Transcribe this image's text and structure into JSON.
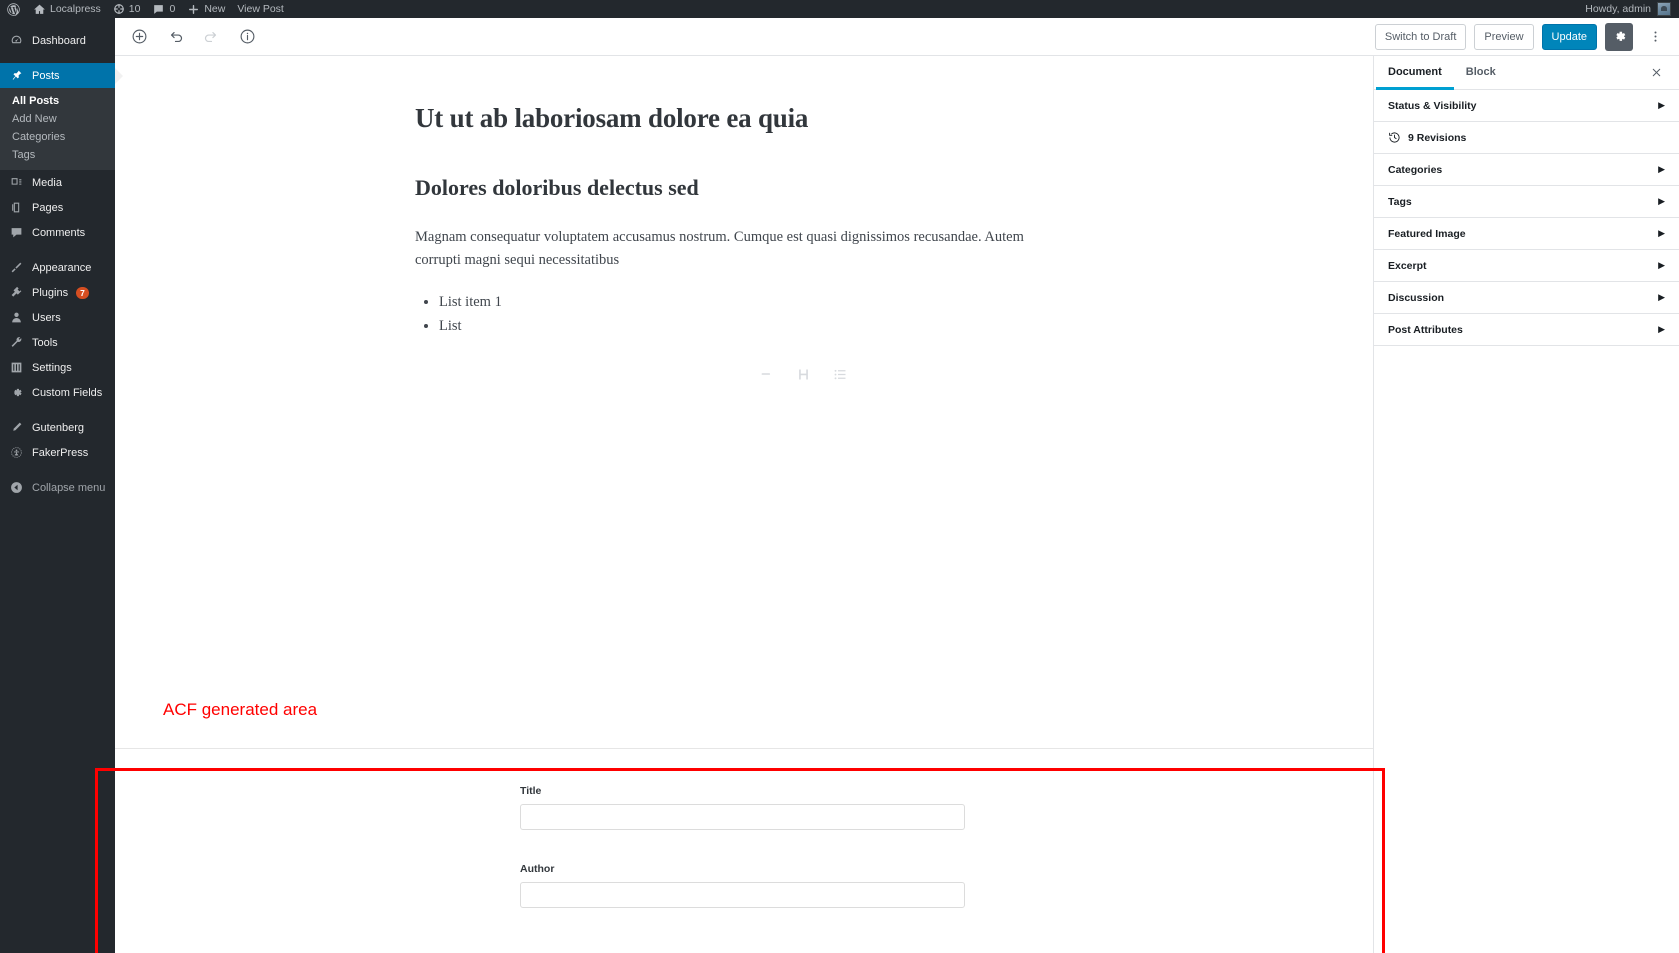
{
  "admin_bar": {
    "logo_icon": "wordpress-logo-icon",
    "items": [
      {
        "icon": "home-icon",
        "label": "Localpress"
      },
      {
        "icon": "updates-icon",
        "label": "10"
      },
      {
        "icon": "comment-icon",
        "label": "0"
      },
      {
        "icon": "plus-icon",
        "label": "New"
      },
      {
        "icon": "",
        "label": "View Post"
      }
    ],
    "account": {
      "greeting": "Howdy, admin",
      "avatar_icon": "avatar-icon"
    }
  },
  "sidebar": {
    "items": [
      {
        "label": "Dashboard",
        "icon": "dashboard-icon",
        "current": false
      },
      {
        "label": "Posts",
        "icon": "pin-icon",
        "current": true
      },
      {
        "label": "Media",
        "icon": "media-icon",
        "current": false
      },
      {
        "label": "Pages",
        "icon": "pages-icon",
        "current": false
      },
      {
        "label": "Comments",
        "icon": "comments-icon",
        "current": false
      },
      {
        "label": "Appearance",
        "icon": "appearance-icon",
        "current": false
      },
      {
        "label": "Plugins",
        "icon": "plugins-icon",
        "current": false,
        "badge": "7"
      },
      {
        "label": "Users",
        "icon": "users-icon",
        "current": false
      },
      {
        "label": "Tools",
        "icon": "tools-icon",
        "current": false
      },
      {
        "label": "Settings",
        "icon": "settings-icon",
        "current": false
      },
      {
        "label": "Custom Fields",
        "icon": "custom-fields-icon",
        "current": false
      },
      {
        "label": "Gutenberg",
        "icon": "gutenberg-icon",
        "current": false
      },
      {
        "label": "FakerPress",
        "icon": "fakerpress-icon",
        "current": false
      }
    ],
    "submenu": [
      {
        "label": "All Posts",
        "current": true
      },
      {
        "label": "Add New",
        "current": false
      },
      {
        "label": "Categories",
        "current": false
      },
      {
        "label": "Tags",
        "current": false
      }
    ],
    "collapse": {
      "label": "Collapse menu",
      "icon": "collapse-icon"
    }
  },
  "editor_header": {
    "tools": [
      {
        "name": "add-block-icon",
        "disabled": false
      },
      {
        "name": "undo-icon",
        "disabled": false
      },
      {
        "name": "redo-icon",
        "disabled": true
      },
      {
        "name": "info-icon",
        "disabled": false
      }
    ],
    "switch_to_draft_label": "Switch to Draft",
    "preview_label": "Preview",
    "update_label": "Update",
    "settings_icon": "gear-icon",
    "more_icon": "ellipsis-vertical-icon",
    "primary_color": "#0085ba"
  },
  "post": {
    "title": "Ut ut ab laboriosam dolore ea quia",
    "heading": "Dolores doloribus delectus sed",
    "paragraph": "Magnam consequatur voluptatem accusamus nostrum. Cumque est quasi dignissimos recusandae. Autem corrupti magni sequi necessitatibus",
    "list_items": [
      "List item 1",
      "List"
    ],
    "appender_icons": [
      "paragraph-block-icon",
      "heading-block-icon",
      "list-block-icon"
    ]
  },
  "annotation": {
    "text": "ACF generated area",
    "color": "#ff0000"
  },
  "acf_fields": [
    {
      "label": "Title",
      "value": "",
      "placeholder": ""
    },
    {
      "label": "Author",
      "value": "",
      "placeholder": ""
    }
  ],
  "settings_panel": {
    "tabs": [
      {
        "label": "Document",
        "active": true
      },
      {
        "label": "Block",
        "active": false
      }
    ],
    "close_icon": "close-icon",
    "accent_color": "#00a0d2",
    "revisions": {
      "icon": "revisions-icon",
      "label": "9 Revisions"
    },
    "panels": [
      {
        "label": "Status & Visibility"
      },
      {
        "label": "Categories"
      },
      {
        "label": "Tags"
      },
      {
        "label": "Featured Image"
      },
      {
        "label": "Excerpt"
      },
      {
        "label": "Discussion"
      },
      {
        "label": "Post Attributes"
      }
    ]
  }
}
